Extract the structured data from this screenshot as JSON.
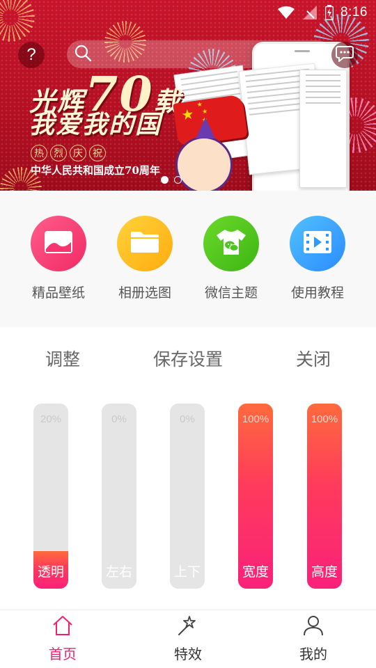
{
  "status_bar": {
    "time": "8:16",
    "icons": [
      "wifi-icon",
      "signal-icon",
      "battery-icon"
    ]
  },
  "banner": {
    "headline_part1": "光辉",
    "headline_number": "70",
    "headline_part2": "载",
    "headline_line2": "我爱我的国",
    "seals": [
      "热",
      "烈",
      "庆",
      "祝"
    ],
    "subline": "中华人民共和国成立70周年",
    "pager_count": 2,
    "pager_active": 0,
    "help_label": "?"
  },
  "search": {
    "placeholder": ""
  },
  "quick_nav": [
    {
      "label": "精品壁纸",
      "icon": "image-icon",
      "color": "#f6356f"
    },
    {
      "label": "相册选图",
      "icon": "folder-icon",
      "color": "#ffc21a"
    },
    {
      "label": "微信主题",
      "icon": "wechat-shirt-icon",
      "color": "#4cc61e"
    },
    {
      "label": "使用教程",
      "icon": "video-icon",
      "color": "#2f9bff"
    }
  ],
  "tabs": {
    "adjust": "调整",
    "save": "保存设置",
    "close": "关闭"
  },
  "sliders": [
    {
      "label": "透明",
      "value_text": "20%",
      "value": 0.2
    },
    {
      "label": "左右",
      "value_text": "0%",
      "value": 0
    },
    {
      "label": "上下",
      "value_text": "0%",
      "value": 0
    },
    {
      "label": "宽度",
      "value_text": "100%",
      "value": 1
    },
    {
      "label": "高度",
      "value_text": "100%",
      "value": 1
    }
  ],
  "bottom_nav": [
    {
      "label": "首页",
      "icon": "home-icon",
      "active": true
    },
    {
      "label": "特效",
      "icon": "magic-wand-icon",
      "active": false
    },
    {
      "label": "我的",
      "icon": "user-icon",
      "active": false
    }
  ],
  "colors": {
    "accent": "#f31f70",
    "banner_red": "#c8142b"
  }
}
